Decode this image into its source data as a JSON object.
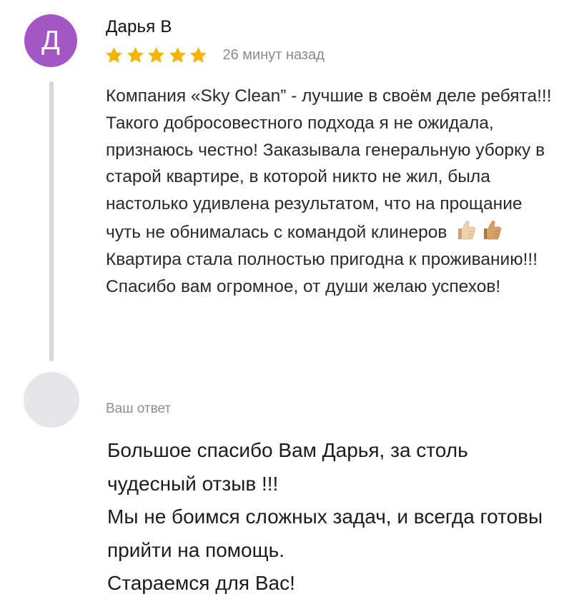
{
  "review": {
    "avatar_letter": "Д",
    "avatar_color": "#a356c4",
    "author": "Дарья В",
    "rating": 5,
    "rating_max": 5,
    "star_color": "#f5b400",
    "time": "26 минут назад",
    "text_before_emoji": "Компания «Sky Clean” - лучшие в своём деле ребята!!! Такого добросовестного подхода я не ожидала, признаюсь честно! Заказывала генеральную уборку в старой квартире, в которой никто не жил, была настолько удивлена результатом, что на прощание чуть не обнималась с командой клинеров",
    "emoji": [
      "thumbs-up",
      "thumbs-up"
    ],
    "text_after_emoji": "Квартира стала полностью пригодна к проживанию!!! Спасибо вам огромное, от души желаю успехов!"
  },
  "reply": {
    "label": "Ваш ответ",
    "lines": [
      "Большое спасибо Вам Дарья, за столь чудесный отзыв !!!",
      "Мы не боимся сложных задач, и всегда готовы прийти на помощь.",
      "Стараемся для Вас!"
    ]
  }
}
